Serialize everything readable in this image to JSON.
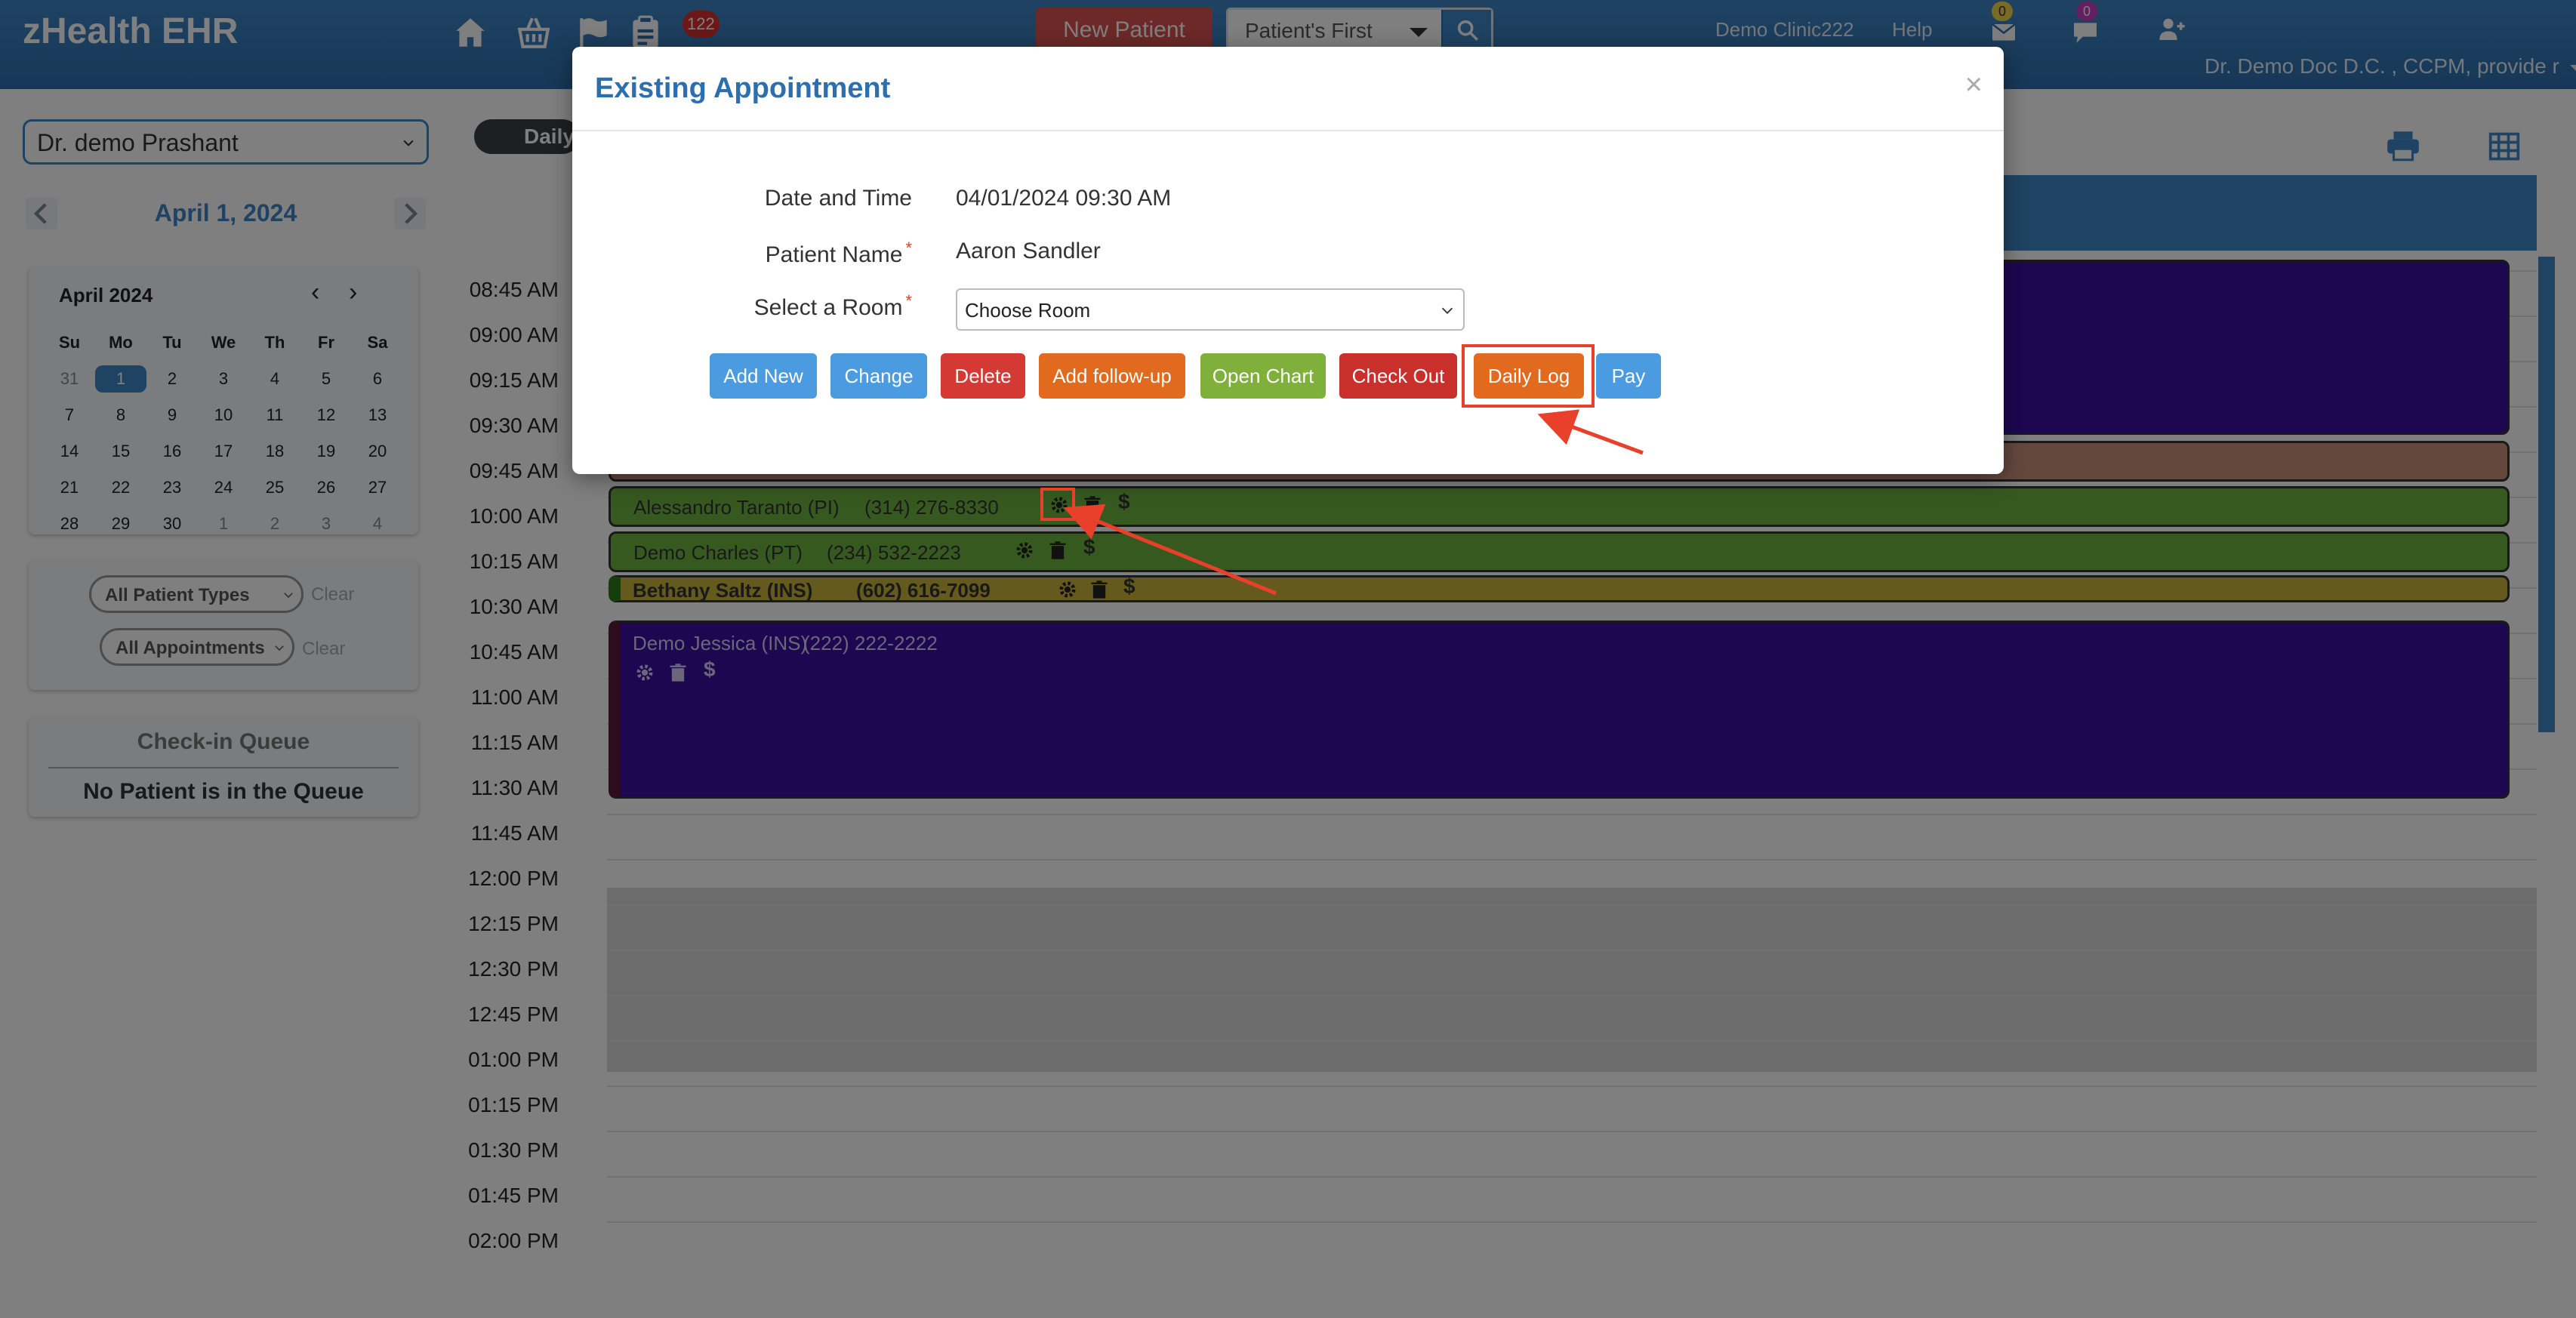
{
  "header": {
    "brand": "zHealth EHR",
    "task_badge": "122",
    "new_patient_label": "New Patient",
    "search_filter_value": "Patient's First",
    "clinic": "Demo Clinic222",
    "help": "Help",
    "mail_badge": "0",
    "chat_badge": "0",
    "user": "Dr. Demo Doc D.C. , CCPM, provide r"
  },
  "sidebar": {
    "provider": "Dr. demo Prashant",
    "current_date": "April 1, 2024",
    "calendar": {
      "month": "April 2024",
      "weekdays": [
        "Su",
        "Mo",
        "Tu",
        "We",
        "Th",
        "Fr",
        "Sa"
      ],
      "weeks": [
        [
          "31",
          "1",
          "2",
          "3",
          "4",
          "5",
          "6"
        ],
        [
          "7",
          "8",
          "9",
          "10",
          "11",
          "12",
          "13"
        ],
        [
          "14",
          "15",
          "16",
          "17",
          "18",
          "19",
          "20"
        ],
        [
          "21",
          "22",
          "23",
          "24",
          "25",
          "26",
          "27"
        ],
        [
          "28",
          "29",
          "30",
          "1",
          "2",
          "3",
          "4"
        ]
      ],
      "selected_day": "1"
    },
    "filters": {
      "patient_types": "All Patient Types",
      "appointments": "All Appointments",
      "clear": "Clear"
    },
    "queue": {
      "title": "Check-in Queue",
      "empty": "No Patient is in the Queue"
    }
  },
  "schedule": {
    "view_tab": "Daily",
    "times": [
      "08:45 AM",
      "09:00 AM",
      "09:15 AM",
      "09:30 AM",
      "09:45 AM",
      "10:00 AM",
      "10:15 AM",
      "10:30 AM",
      "10:45 AM",
      "11:00 AM",
      "11:15 AM",
      "11:30 AM",
      "11:45 AM",
      "12:00 PM",
      "12:15 PM",
      "12:30 PM",
      "12:45 PM",
      "01:00 PM",
      "01:15 PM",
      "01:30 PM",
      "01:45 PM",
      "02:00 PM"
    ],
    "appointments": [
      {
        "name": "Alessandro Taranto (PI)",
        "phone": "(314) 276-8330",
        "color": "#6db33f"
      },
      {
        "name": "Demo Charles (PT)",
        "phone": "(234) 532-2223",
        "color": "#6db33f"
      },
      {
        "name": "Bethany Saltz (INS)",
        "phone": "(602) 616-7099",
        "color": "#c9b43a"
      },
      {
        "name": "Demo Jessica (INS)",
        "phone": "(222) 222-2222",
        "color": "#3a0ea0"
      }
    ],
    "dollar": "$"
  },
  "modal": {
    "title": "Existing Appointment",
    "close": "×",
    "date_label": "Date and Time",
    "date_value": "04/01/2024 09:30 AM",
    "patient_label": "Patient Name",
    "patient_value": "Aaron Sandler",
    "room_label": "Select a Room",
    "room_value": "Choose Room",
    "required_mark": "*",
    "buttons": {
      "add_new": "Add New",
      "change": "Change",
      "delete": "Delete",
      "follow_up": "Add follow-up",
      "open_chart": "Open Chart",
      "check_out": "Check Out",
      "daily_log": "Daily Log",
      "pay": "Pay"
    }
  },
  "colors": {
    "brand_blue": "#3f86c6",
    "annotation_red": "#e8402a",
    "appointment_purple": "#3a0ea0",
    "appointment_green": "#6db33f",
    "appointment_gold": "#c9b43a"
  }
}
